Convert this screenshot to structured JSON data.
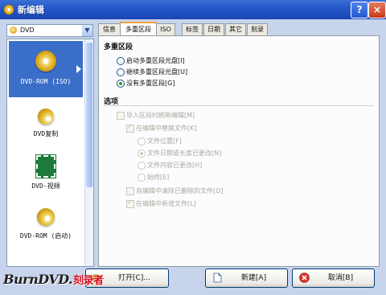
{
  "window": {
    "title": "新编辑",
    "help_label": "?",
    "close_label": "×"
  },
  "left": {
    "dropdown_value": "DVD",
    "dropdown_arrow": "▼",
    "items": [
      {
        "label": "DVD-ROM (ISO)",
        "icon": "disc-iso-icon",
        "selected": true
      },
      {
        "label": "DVD复制",
        "icon": "disc-copy-icon",
        "selected": false
      },
      {
        "label": "DVD-视频",
        "icon": "dvd-video-icon",
        "selected": false
      },
      {
        "label": "DVD-ROM (启动)",
        "icon": "dvd-boot-icon",
        "selected": false
      }
    ]
  },
  "tabs": [
    "信息",
    "多重区段",
    "ISO",
    "标签",
    "日期",
    "其它",
    "刻录"
  ],
  "multisession": {
    "heading": "多重区段",
    "options": [
      {
        "label": "启动多重区段光盘[I]",
        "checked": false
      },
      {
        "label": "继续多重区段光盘[U]",
        "checked": false
      },
      {
        "label": "没有多重区段[G]",
        "checked": true
      }
    ]
  },
  "options": {
    "heading": "选项",
    "import_session": "导入区段时刷新编辑[M]",
    "replace_in_edit": "在编辑中替换文件[K]",
    "sub_options": [
      {
        "label": "文件位置[F]",
        "checked": false
      },
      {
        "label": "文件日期或长度已更改[N]",
        "checked": true
      },
      {
        "label": "文件内容已更改[H]",
        "checked": false
      },
      {
        "label": "始终[E]",
        "checked": false
      }
    ],
    "auto_remove_deleted": "自编辑中清除已删除的文件[O]",
    "mark_new_files": "在编辑中新增文件[L]"
  },
  "buttons": {
    "open": "打开[C]...",
    "new": "新建[A]",
    "cancel": "取消[B]"
  },
  "watermark": {
    "brand": "BurnDVD.",
    "suffix": "刻录者"
  }
}
